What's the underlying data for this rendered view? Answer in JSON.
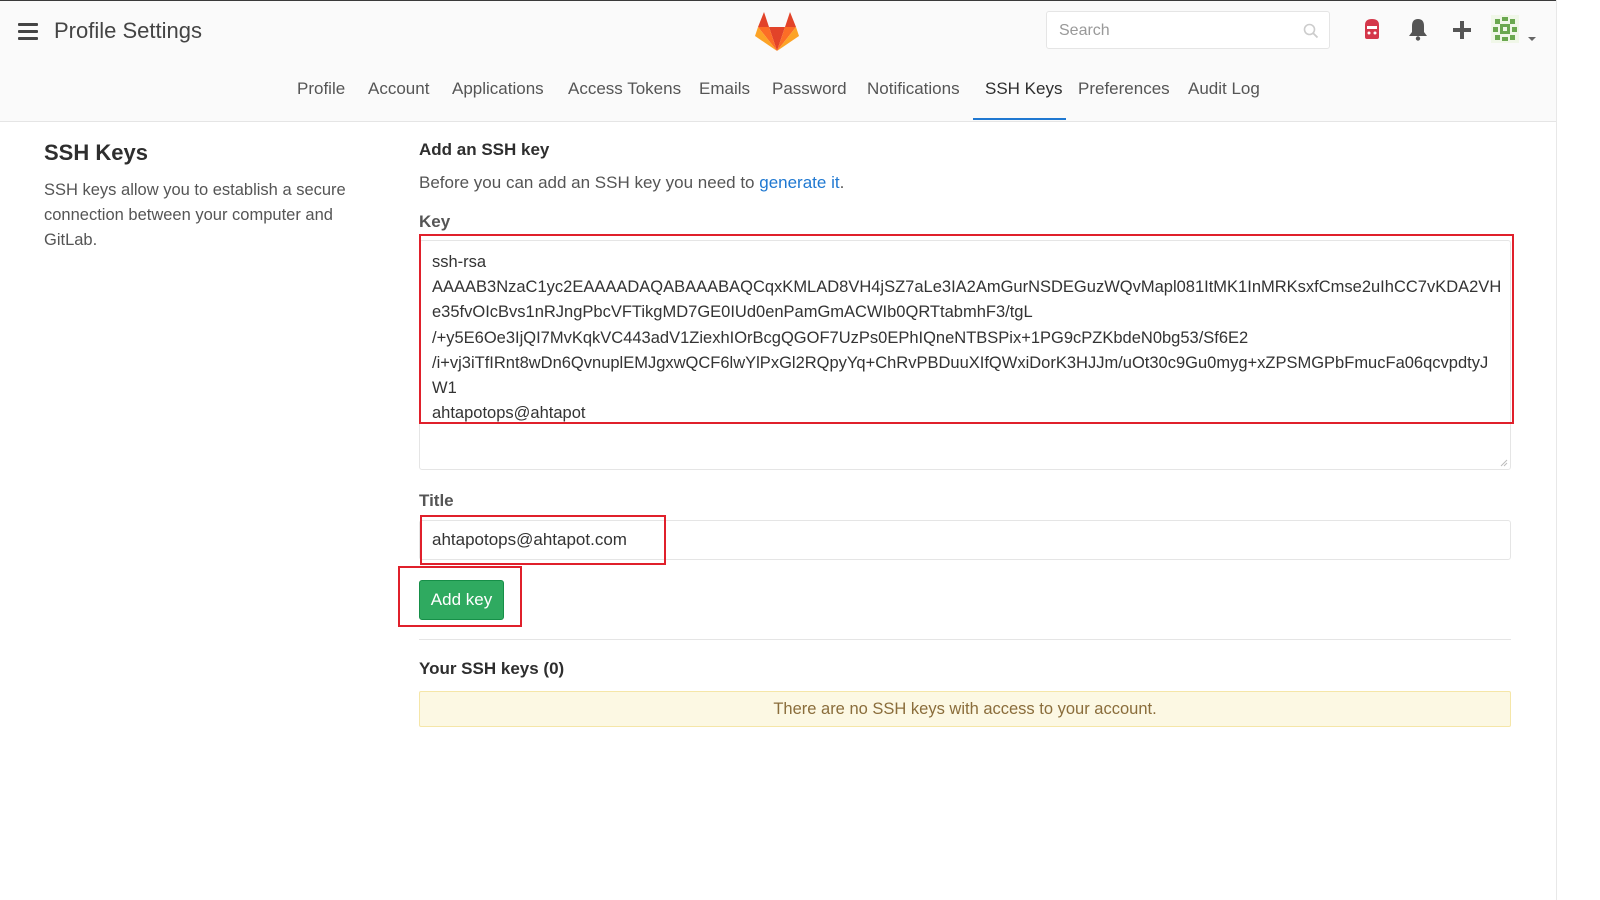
{
  "header": {
    "title": "Profile Settings",
    "search_placeholder": "Search"
  },
  "tabs": [
    {
      "label": "Profile"
    },
    {
      "label": "Account"
    },
    {
      "label": "Applications"
    },
    {
      "label": "Access Tokens"
    },
    {
      "label": "Emails"
    },
    {
      "label": "Password"
    },
    {
      "label": "Notifications"
    },
    {
      "label": "SSH Keys",
      "active": true
    },
    {
      "label": "Preferences"
    },
    {
      "label": "Audit Log"
    }
  ],
  "sidebar": {
    "title": "SSH Keys",
    "description": "SSH keys allow you to establish a secure connection between your computer and GitLab."
  },
  "form": {
    "heading": "Add an SSH key",
    "intro_text": "Before you can add an SSH key you need to ",
    "intro_link": "generate it",
    "intro_end": ".",
    "key_label": "Key",
    "key_value": "ssh-rsa\nAAAAB3NzaC1yc2EAAAADAQABAAABAQCqxKMLAD8VH4jSZ7aLe3IA2AmGurNSDEGuzWQvMapl081ItMK1InMRKsxfCmse2uIhCC7vKDA2VHe35fvOIcBvs1nRJngPbcVFTikgMD7GE0IUd0enPamGmACWIb0QRTtabmhF3/tgL\n/+y5E6Oe3IjQI7MvKqkVC443adV1ZiexhIOrBcgQGOF7UzPs0EPhIQneNTBSPix+1PG9cPZKbdeN0bg53/Sf6E2\n/i+vj3iTfIRnt8wDn6QvnuplEMJgxwQCF6lwYlPxGl2RQpyYq+ChRvPBDuuXIfQWxiDorK3HJJm/uOt30c9Gu0myg+xZPSMGPbFmucFa06qcvpdtyJW1\nahtapotops@ahtapot",
    "title_label": "Title",
    "title_value": "ahtapotops@ahtapot.com",
    "submit_label": "Add key"
  },
  "keys_list": {
    "heading": "Your SSH keys (0)",
    "empty_message": "There are no SSH keys with access to your account."
  },
  "colors": {
    "accent": "#1f78d1",
    "primary_button": "#2faa60",
    "highlight_box": "#e0202b",
    "warning_bg": "#fcf8e3"
  },
  "icons": [
    "hamburger-icon",
    "gitlab-logo",
    "search-icon",
    "todo-icon",
    "bell-icon",
    "plus-icon",
    "avatar",
    "chevron-down-icon"
  ]
}
